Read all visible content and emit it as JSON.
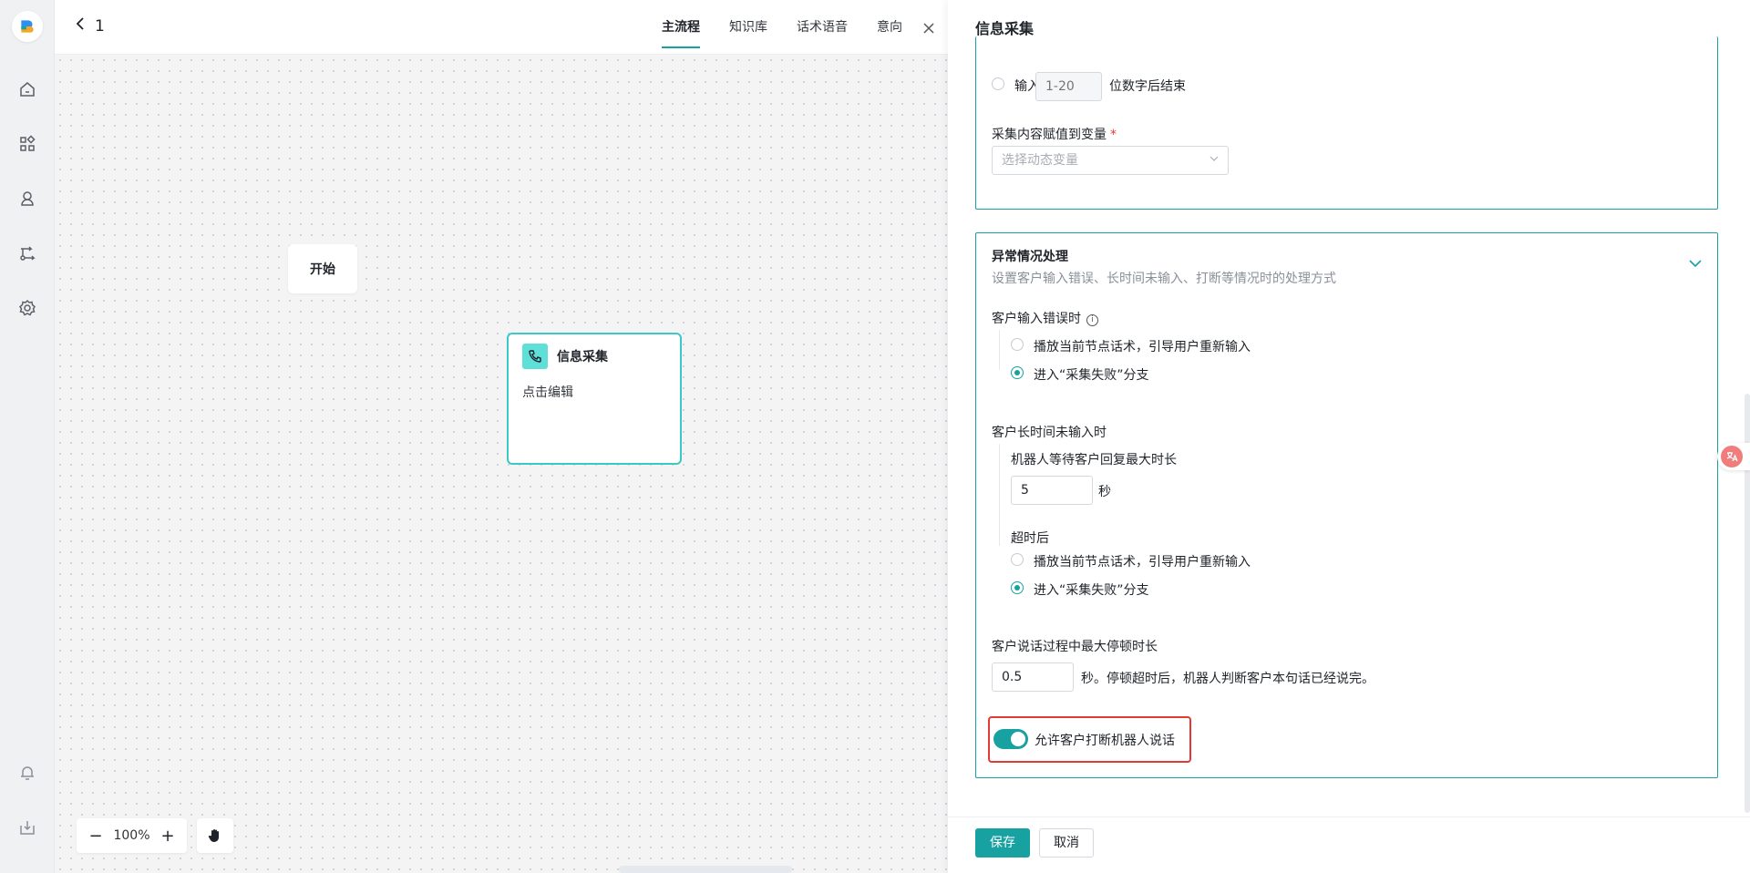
{
  "topbar": {
    "title": "1",
    "tabs": [
      "主流程",
      "知识库",
      "话术语音",
      "意向"
    ]
  },
  "canvas": {
    "start_node": "开始",
    "info_node": {
      "title": "信息采集",
      "desc": "点击编辑"
    },
    "zoom": "100%"
  },
  "panel": {
    "title": "信息采集",
    "input_row": {
      "prefix": "输入",
      "placeholder": "1-20",
      "suffix": "位数字后结束"
    },
    "assign_label": "采集内容赋值到变量",
    "assign_required": "*",
    "assign_placeholder": "选择动态变量",
    "exception": {
      "title": "异常情况处理",
      "subtitle": "设置客户输入错误、长时间未输入、打断等情况时的处理方式",
      "error_label": "客户输入错误时",
      "error_options": [
        "播放当前节点话术，引导用户重新输入",
        "进入“采集失败”分支"
      ],
      "error_selected": 1,
      "timeout_label": "客户长时间未输入时",
      "wait_label": "机器人等待客户回复最大时长",
      "wait_value": "5",
      "wait_unit": "秒",
      "after_label": "超时后",
      "after_options": [
        "播放当前节点话术，引导用户重新输入",
        "进入“采集失败”分支"
      ],
      "after_selected": 1,
      "pause_label": "客户说话过程中最大停顿时长",
      "pause_value": "0.5",
      "pause_hint": "秒。停顿超时后，机器人判断客户本句话已经说完。",
      "interrupt_label": "允许客户打断机器人说话",
      "interrupt_enabled": true
    },
    "buttons": {
      "save": "保存",
      "cancel": "取消"
    }
  },
  "colors": {
    "accent": "#17a2a1",
    "highlight": "#e53935"
  }
}
